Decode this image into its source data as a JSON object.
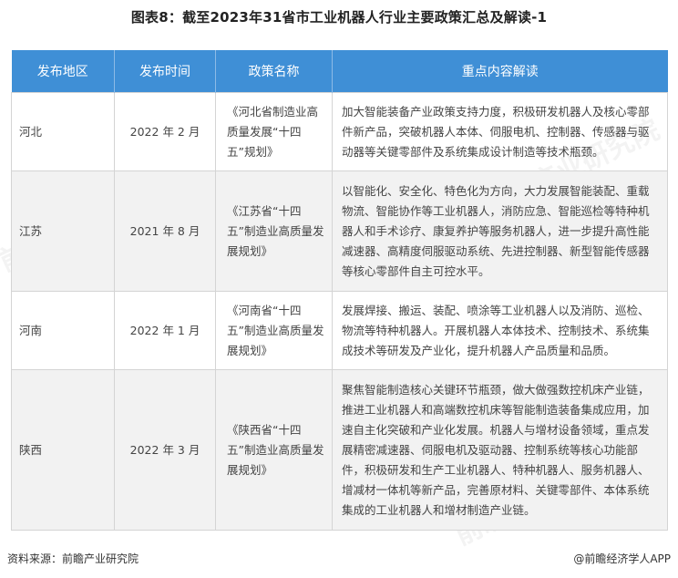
{
  "title": "图表8：截至2023年31省市工业机器人行业主要政策汇总及解读-1",
  "table": {
    "headers": [
      "发布地区",
      "发布时间",
      "政策名称",
      "重点内容解读"
    ],
    "rows": [
      {
        "region": "河北",
        "date": "2022 年 2 月",
        "name": "《河北省制造业高质量发展“十四五”规划》",
        "content": "加大智能装备产业政策支持力度，积极研发机器人及核心零部件新产品，突破机器人本体、伺服电机、控制器、传感器与驱动器等关键零部件及系统集成设计制造等技术瓶颈。"
      },
      {
        "region": "江苏",
        "date": "2021 年 8 月",
        "name": "《江苏省“十四五”制造业高质量发展规划》",
        "content": "以智能化、安全化、特色化为方向，大力发展智能装配、重载物流、智能协作等工业机器人，消防应急、智能巡检等特种机器人和手术诊疗、康复养护等服务机器人，进一步提升高性能减速器、高精度伺服驱动系统、先进控制器、新型智能传感器等核心零部件自主可控水平。"
      },
      {
        "region": "河南",
        "date": "2022 年 1 月",
        "name": "《河南省“十四五”制造业高质量发展规划》",
        "content": "发展焊接、搬运、装配、喷涂等工业机器人以及消防、巡检、物流等特种机器人。开展机器人本体技术、控制技术、系统集成技术等研发及产业化，提升机器人产品质量和品质。"
      },
      {
        "region": "陕西",
        "date": "2022 年 3 月",
        "name": "《陕西省“十四五”制造业高质量发展规划》",
        "content": "聚焦智能制造核心关键环节瓶颈，做大做强数控机床产业链，推进工业机器人和高端数控机床等智能制造装备集成应用，加速自主化突破和产业化发展。机器人与增材设备领域，重点发展精密减速器、伺服电机及驱动器、控制系统等核心功能部件，积极研发和生产工业机器人、特种机器人、服务机器人、增减材一体机等新产品，完善原材料、关键零部件、本体系统集成的工业机器人和增材制造产业链。"
      }
    ]
  },
  "footer": {
    "source": "资料来源：前瞻产业研究院",
    "brand": "@前瞻经济学人APP"
  },
  "watermark": "前瞻产业研究院",
  "colors": {
    "header_bg": "#3f8fd6",
    "alt_row_bg": "#f2f2f2"
  }
}
